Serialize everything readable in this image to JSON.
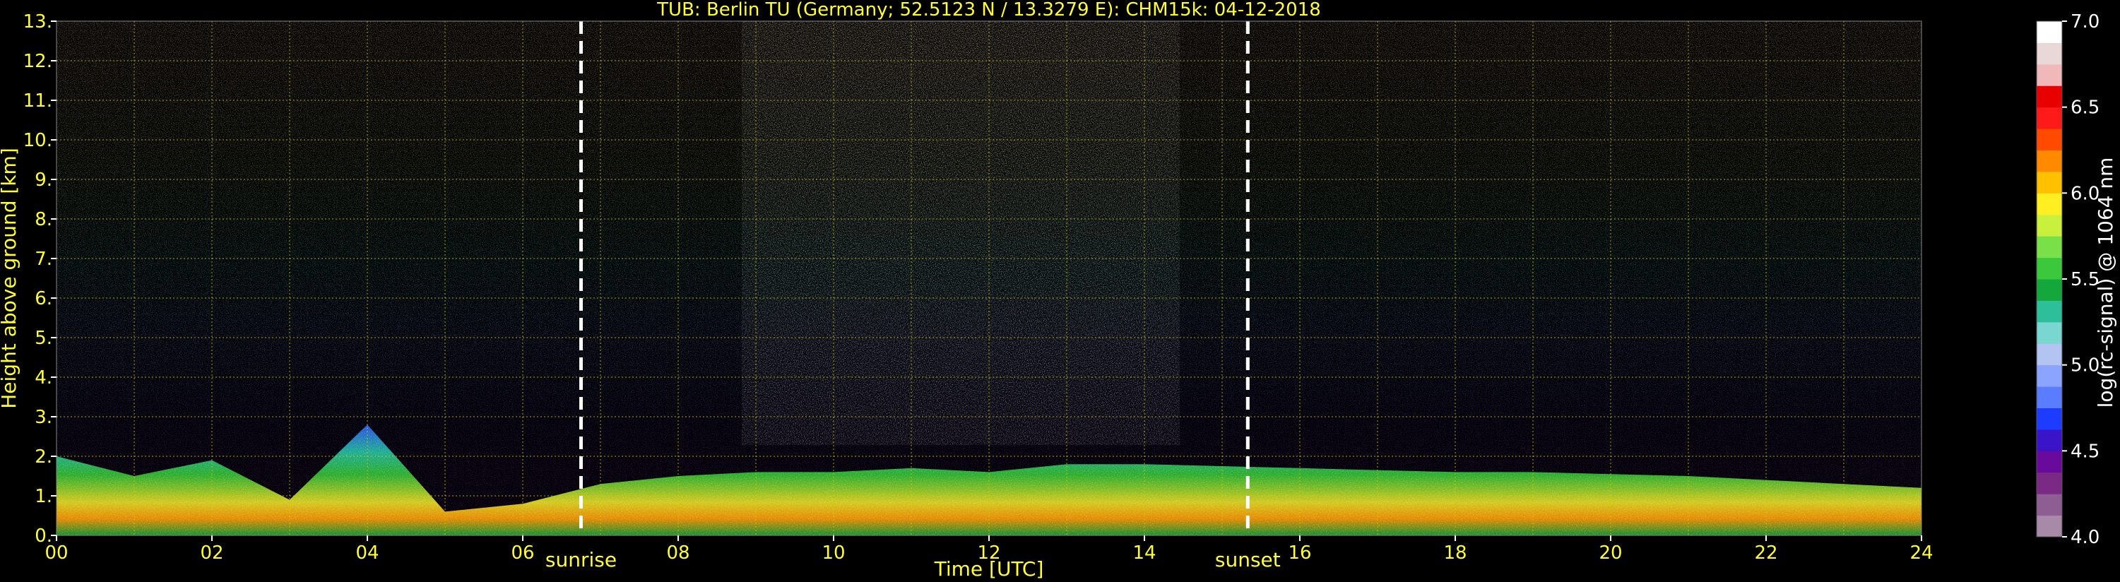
{
  "chart_data": {
    "type": "heatmap",
    "title": "TUB: Berlin TU (Germany; 52.5123 N / 13.3279 E):    CHM15k: 04-12-2018",
    "xlabel": "Time [UTC]",
    "ylabel": "Height above ground [km]",
    "xlim": [
      0,
      24
    ],
    "ylim": [
      0,
      13
    ],
    "x_ticks": [
      "00",
      "02",
      "04",
      "06",
      "08",
      "10",
      "12",
      "14",
      "16",
      "18",
      "20",
      "22",
      "24"
    ],
    "y_ticks": [
      "0.",
      "1.",
      "2.",
      "3.",
      "4.",
      "5.",
      "6.",
      "7.",
      "8.",
      "9.",
      "10.",
      "11.",
      "12.",
      "13."
    ],
    "grid": true,
    "markers": [
      {
        "label": "sunrise",
        "time_hours": 6.75
      },
      {
        "label": "sunset",
        "time_hours": 15.33
      }
    ],
    "colorbar": {
      "label": "log(rc-signal) @ 1064 nm",
      "range": [
        4.0,
        7.0
      ],
      "ticks": [
        "4.0",
        "4.5",
        "5.0",
        "5.5",
        "6.0",
        "6.5",
        "7.0"
      ],
      "colors": [
        "#a68aa8",
        "#8e5d92",
        "#7a2a84",
        "#6a0a9c",
        "#3a14c8",
        "#1e3cff",
        "#5a7cff",
        "#8aa4ff",
        "#b4c4f2",
        "#7ad6d0",
        "#2cbf9a",
        "#14a83c",
        "#3cc83c",
        "#7ae04a",
        "#c8f03c",
        "#ffee22",
        "#ffc000",
        "#ff8a00",
        "#ff4a00",
        "#ff1a1a",
        "#e80000",
        "#f0b8b8",
        "#ead8d8",
        "#ffffff"
      ]
    },
    "boundary_layer_top_km": {
      "times": [
        0,
        1,
        2,
        3,
        4,
        5,
        6,
        7,
        8,
        9,
        10,
        11,
        12,
        13,
        14,
        15,
        16,
        17,
        18,
        19,
        20,
        21,
        22,
        23,
        24
      ],
      "heights": [
        2.0,
        1.5,
        1.9,
        0.9,
        2.8,
        0.6,
        0.8,
        1.3,
        1.5,
        1.6,
        1.6,
        1.7,
        1.6,
        1.8,
        1.8,
        1.75,
        1.7,
        1.65,
        1.6,
        1.6,
        1.55,
        1.5,
        1.4,
        1.3,
        1.2
      ]
    }
  }
}
